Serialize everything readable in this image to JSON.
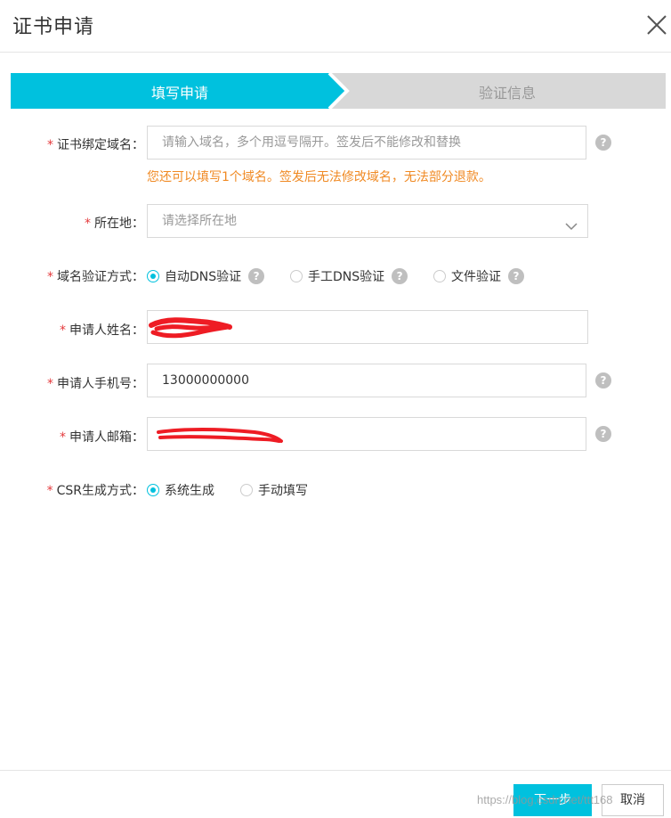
{
  "dialog": {
    "title": "证书申请"
  },
  "steps": {
    "active": "填写申请",
    "inactive": "验证信息"
  },
  "form": {
    "domain": {
      "label": "证书绑定域名：",
      "placeholder": "请输入域名，多个用逗号隔开。签发后不能修改和替换",
      "hint": "您还可以填写1个域名。签发后无法修改域名，无法部分退款。"
    },
    "location": {
      "label": "所在地：",
      "placeholder": "请选择所在地"
    },
    "verify_method": {
      "label": "域名验证方式：",
      "options": [
        "自动DNS验证",
        "手工DNS验证",
        "文件验证"
      ],
      "selected": "自动DNS验证"
    },
    "applicant_name": {
      "label": "申请人姓名："
    },
    "applicant_phone": {
      "label": "申请人手机号：",
      "value": "13000000000"
    },
    "applicant_email": {
      "label": "申请人邮箱："
    },
    "csr_method": {
      "label": "CSR生成方式：",
      "options": [
        "系统生成",
        "手动填写"
      ],
      "selected": "系统生成"
    },
    "required_mark": "*",
    "help_mark": "?"
  },
  "footer": {
    "next_label": "下一步",
    "cancel_label": "取消"
  },
  "watermark": "https://blog.csdn.net/ttt168",
  "colors": {
    "accent": "#00c1de",
    "hint": "#f08a24",
    "required": "#e4393c",
    "redaction": "#ee1c24"
  }
}
